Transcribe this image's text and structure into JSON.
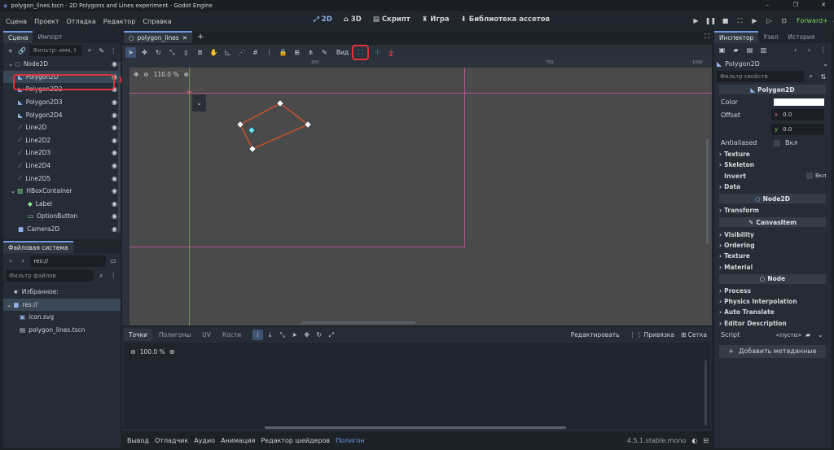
{
  "window": {
    "title": "polygon_lines.tscn - 2D Polygons and Lines experiment - Godot Engine"
  },
  "menu": {
    "items": [
      "Сцена",
      "Проект",
      "Отладка",
      "Редактор",
      "Справка"
    ]
  },
  "workspaces": {
    "w2d": "2D",
    "w3d": "3D",
    "script": "Скрипт",
    "game": "Игра",
    "assetlib": "Библиотека ассетов"
  },
  "renderer": "Forward+",
  "scene_dock": {
    "tabs": [
      "Сцена",
      "Импорт"
    ],
    "filter_placeholder": "Фильтр: имя, t",
    "nodes": [
      {
        "name": "Node2D",
        "icon": "node2d-icon",
        "color": "#8fb3e8"
      },
      {
        "name": "Polygon2D",
        "icon": "polygon2d-icon",
        "color": "#8fb3e8"
      },
      {
        "name": "Polygon2D2",
        "icon": "polygon2d-icon",
        "color": "#8fb3e8"
      },
      {
        "name": "Polygon2D3",
        "icon": "polygon2d-icon",
        "color": "#8fb3e8"
      },
      {
        "name": "Polygon2D4",
        "icon": "polygon2d-icon",
        "color": "#8fb3e8"
      },
      {
        "name": "Line2D",
        "icon": "line2d-icon",
        "color": "#8fb3e8"
      },
      {
        "name": "Line2D2",
        "icon": "line2d-icon",
        "color": "#8fb3e8"
      },
      {
        "name": "Line2D3",
        "icon": "line2d-icon",
        "color": "#8fb3e8"
      },
      {
        "name": "Line2D4",
        "icon": "line2d-icon",
        "color": "#8fb3e8"
      },
      {
        "name": "Line2D5",
        "icon": "line2d-icon",
        "color": "#8fb3e8"
      },
      {
        "name": "HBoxContainer",
        "icon": "hbox-icon",
        "color": "#8eef97"
      },
      {
        "name": "Label",
        "icon": "label-icon",
        "color": "#8eef97"
      },
      {
        "name": "OptionButton",
        "icon": "option-button-icon",
        "color": "#8eef97"
      },
      {
        "name": "Camera2D",
        "icon": "camera2d-icon",
        "color": "#8fb3e8"
      }
    ],
    "annotation_1": "1"
  },
  "filesystem": {
    "tab": "Файловая система",
    "path": "res://",
    "filter_placeholder": "Фильтр файлов",
    "favorites": "Избранное:",
    "items": [
      "res://",
      "icon.svg",
      "polygon_lines.tscn"
    ]
  },
  "editor": {
    "tab": "polygon_lines",
    "view_label": "Вид",
    "zoom": "110.0 %",
    "annotation_2": "2",
    "ruler_marks": [
      "200",
      "750",
      "1000"
    ]
  },
  "bottom_panel": {
    "tabs": [
      "Точки",
      "Полигоны",
      "UV",
      "Кости"
    ],
    "edit_label": "Редактировать",
    "snap_label": "Привязка",
    "grid_label": "Сетка",
    "zoom": "100.0 %"
  },
  "statusbar": {
    "tabs": [
      "Вывод",
      "Отладчик",
      "Аудио",
      "Анимация",
      "Редактор шейдеров",
      "Полигон"
    ],
    "version": "4.5.1.stable.mono"
  },
  "inspector": {
    "tabs": [
      "Инспектор",
      "Узел",
      "История"
    ],
    "node_name": "Polygon2D",
    "filter_placeholder": "Фильтр свойств",
    "class_polygon": "Polygon2D",
    "color_label": "Color",
    "color_value": "#ffffff",
    "offset_label": "Offset",
    "offset_x_label": "x",
    "offset_x": "0.0",
    "offset_y_label": "y",
    "offset_y": "0.0",
    "antialiased_label": "Antialiased",
    "antialiased_value": "Вкл",
    "sections1": [
      "Texture",
      "Skeleton"
    ],
    "invert_label": "Invert",
    "invert_value": "Вкл",
    "data_label": "Data",
    "class_node2d": "Node2D",
    "transform_label": "Transform",
    "class_canvasitem": "CanvasItem",
    "sections2": [
      "Visibility",
      "Ordering",
      "Texture",
      "Material"
    ],
    "class_node": "Node",
    "sections3": [
      "Process",
      "Physics Interpolation",
      "Auto Translate",
      "Editor Description"
    ],
    "script_label": "Script",
    "script_value": "<пусто>",
    "add_metadata": "Добавить метаданные"
  }
}
